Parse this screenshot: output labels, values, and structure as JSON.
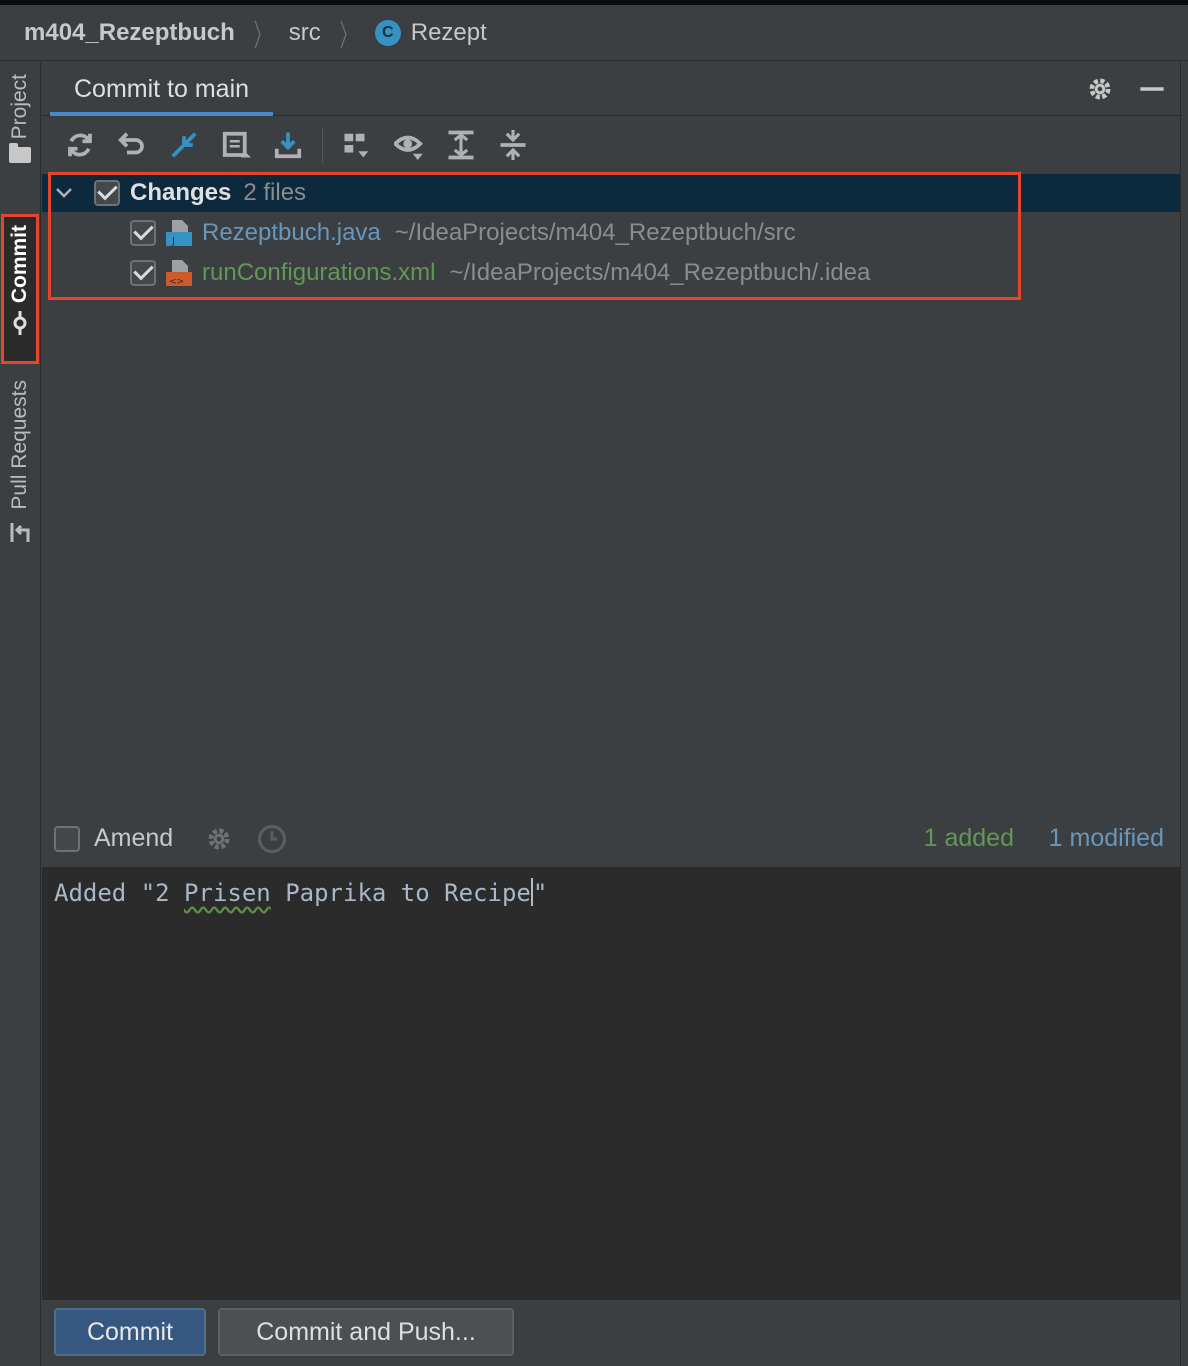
{
  "breadcrumb": {
    "project": "m404_Rezeptbuch",
    "folder": "src",
    "class_icon_letter": "C",
    "class_name": "Rezept"
  },
  "stripe": {
    "project": "Project",
    "commit": "Commit",
    "pull_requests": "Pull Requests"
  },
  "panel": {
    "tab_title": "Commit to main"
  },
  "toolbar": {
    "icons": [
      "refresh-icon",
      "rollback-icon",
      "diff-icon",
      "shelve-icon",
      "update-icon",
      "group-by-icon",
      "view-options-icon",
      "expand-all-icon",
      "collapse-all-icon"
    ]
  },
  "changes": {
    "group_label": "Changes",
    "group_count": "2 files",
    "files": [
      {
        "name": "Rezeptbuch.java",
        "path": "~/IdeaProjects/m404_Rezeptbuch/src",
        "status": "modified",
        "color": "#6897bb",
        "icon_letter": "J",
        "icon_color": "#3592c4"
      },
      {
        "name": "runConfigurations.xml",
        "path": "~/IdeaProjects/m404_Rezeptbuch/.idea",
        "status": "added",
        "color": "#629755",
        "icon_letter": "<>",
        "icon_color": "#cc5a2a"
      }
    ]
  },
  "amend": {
    "label": "Amend",
    "added": "1 added",
    "modified": "1 modified"
  },
  "message": {
    "before": "Added \"2 ",
    "typo": "Prisen",
    "middle": " Paprika to Recipe",
    "after": "\""
  },
  "buttons": {
    "commit": "Commit",
    "commit_and_push": "Commit and Push..."
  },
  "colors": {
    "accent": "#4a88c7",
    "highlight": "#e5452b",
    "added": "#629755",
    "modified": "#6897bb"
  }
}
